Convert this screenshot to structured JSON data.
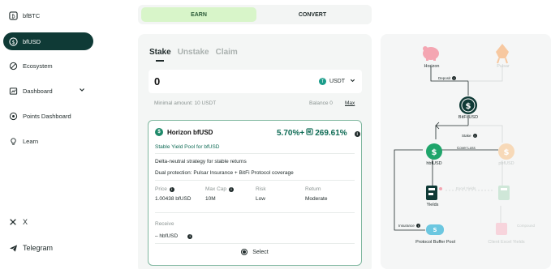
{
  "sidebar": {
    "items": [
      {
        "label": "bfBTC",
        "icon": "bitcoin-icon"
      },
      {
        "label": "bfUSD",
        "icon": "dollar-icon"
      },
      {
        "label": "Ecosystem",
        "icon": "globe-icon"
      },
      {
        "label": "Dashboard",
        "icon": "dashboard-icon"
      },
      {
        "label": "Points Dashboard",
        "icon": "points-icon"
      },
      {
        "label": "Learn",
        "icon": "learn-icon"
      },
      {
        "label": "X",
        "icon": "x-icon"
      },
      {
        "label": "Telegram",
        "icon": "telegram-icon"
      }
    ]
  },
  "tabs": {
    "earn": "EARN",
    "convert": "CONVERT"
  },
  "subtabs": {
    "stake": "Stake",
    "unstake": "Unstake",
    "claim": "Claim"
  },
  "amount": {
    "value": "0",
    "token": "USDT"
  },
  "min_amount": "Minimal amount: 10 USDT",
  "balance": "Balance 0",
  "max": "Max",
  "pool": {
    "name": "Horizon bfUSD",
    "apy": "5.70%+",
    "bonus": "269.61%",
    "subtitle": "Stable Yield Pool for bfUSD",
    "desc1": "Delta-neutral strategy for stable returns",
    "desc2": "Dual protection: Pulsar Insurance + BitFi Protocol coverage",
    "stats": {
      "price_label": "Price",
      "price_value": "1.00438 bfUSD",
      "maxcap_label": "Max Cap",
      "maxcap_value": "10M",
      "risk_label": "Risk",
      "risk_value": "Low",
      "return_label": "Return",
      "return_value": "Moderate"
    },
    "receive_label": "Receive",
    "receive_value": "– hbfUSD",
    "select": "Select"
  },
  "diagram": {
    "horizon": "Horizon",
    "pulsar": "Pulsar",
    "deposit": "Deposit",
    "bitfi_usd": "BitFi USD",
    "stake": "Stake",
    "cover_loss": "Cover Loss",
    "hbfusd": "hbfUSD",
    "pbfusd": "pbfUSD",
    "yields": "Yields",
    "yields_faded": "Excel Yields",
    "insurance": "Insurance",
    "protocol_buffer": "Protocol Buffer Pool",
    "compound": "Compound",
    "client_excel": "Client Excel Yields",
    "colors": {
      "accent": "#0f6b55",
      "pink": "#f4a6b2",
      "orange": "#f7c8a0",
      "green": "#1f8a6a"
    }
  }
}
